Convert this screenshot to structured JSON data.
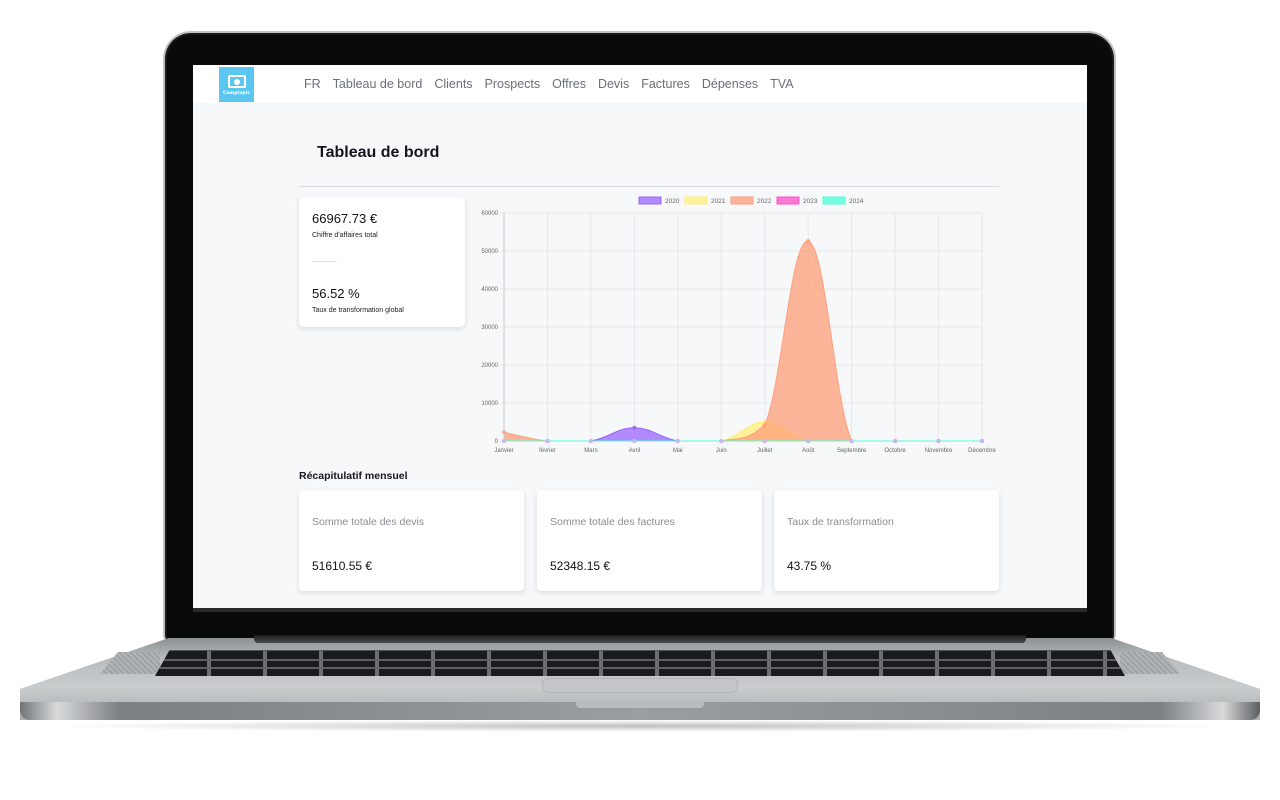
{
  "app": {
    "logo_text": "Comptapic",
    "nav": [
      {
        "label": "FR"
      },
      {
        "label": "Tableau de bord"
      },
      {
        "label": "Clients"
      },
      {
        "label": "Prospects"
      },
      {
        "label": "Offres"
      },
      {
        "label": "Devis"
      },
      {
        "label": "Factures"
      },
      {
        "label": "Dépenses"
      },
      {
        "label": "TVA"
      }
    ]
  },
  "page": {
    "title": "Tableau de bord"
  },
  "kpis": {
    "revenue_value": "66967.73 €",
    "revenue_label": "Chiffre d'affaires total",
    "rate_value": "56.52 %",
    "rate_label": "Taux de transformation global"
  },
  "monthly": {
    "title": "Récapitulatif mensuel",
    "cards": [
      {
        "label": "Somme totale des devis",
        "value": "51610.55 €"
      },
      {
        "label": "Somme totale des factures",
        "value": "52348.15 €"
      },
      {
        "label": "Taux de transformation",
        "value": "43.75 %"
      }
    ]
  },
  "chart_data": {
    "type": "area",
    "title": "",
    "xlabel": "",
    "ylabel": "",
    "categories": [
      "Janvier",
      "février",
      "Mars",
      "Avril",
      "Mai",
      "Juin",
      "Juillet",
      "Août",
      "Septembre",
      "Octobre",
      "Novembre",
      "Décembre"
    ],
    "ylim": [
      0,
      60000
    ],
    "yticks": [
      0,
      10000,
      20000,
      30000,
      40000,
      50000,
      60000
    ],
    "grid": true,
    "legend_position": "top-center",
    "series": [
      {
        "name": "2020",
        "color": "#9966ff",
        "values": [
          0,
          0,
          0,
          3500,
          0,
          0,
          0,
          0,
          0,
          0,
          0,
          0
        ]
      },
      {
        "name": "2021",
        "color": "#ffef7a",
        "values": [
          0,
          0,
          0,
          0,
          0,
          0,
          5000,
          0,
          0,
          0,
          0,
          0
        ]
      },
      {
        "name": "2022",
        "color": "#ff9f7a",
        "values": [
          2300,
          0,
          0,
          0,
          0,
          0,
          4200,
          52600,
          0,
          0,
          0,
          0
        ]
      },
      {
        "name": "2023",
        "color": "#ff4fc8",
        "values": [
          0,
          0,
          0,
          0,
          0,
          0,
          0,
          0,
          0,
          0,
          0,
          0
        ]
      },
      {
        "name": "2024",
        "color": "#4fffd8",
        "values": [
          0,
          0,
          0,
          0,
          0,
          0,
          0,
          0,
          0,
          0,
          0,
          0
        ]
      }
    ]
  }
}
